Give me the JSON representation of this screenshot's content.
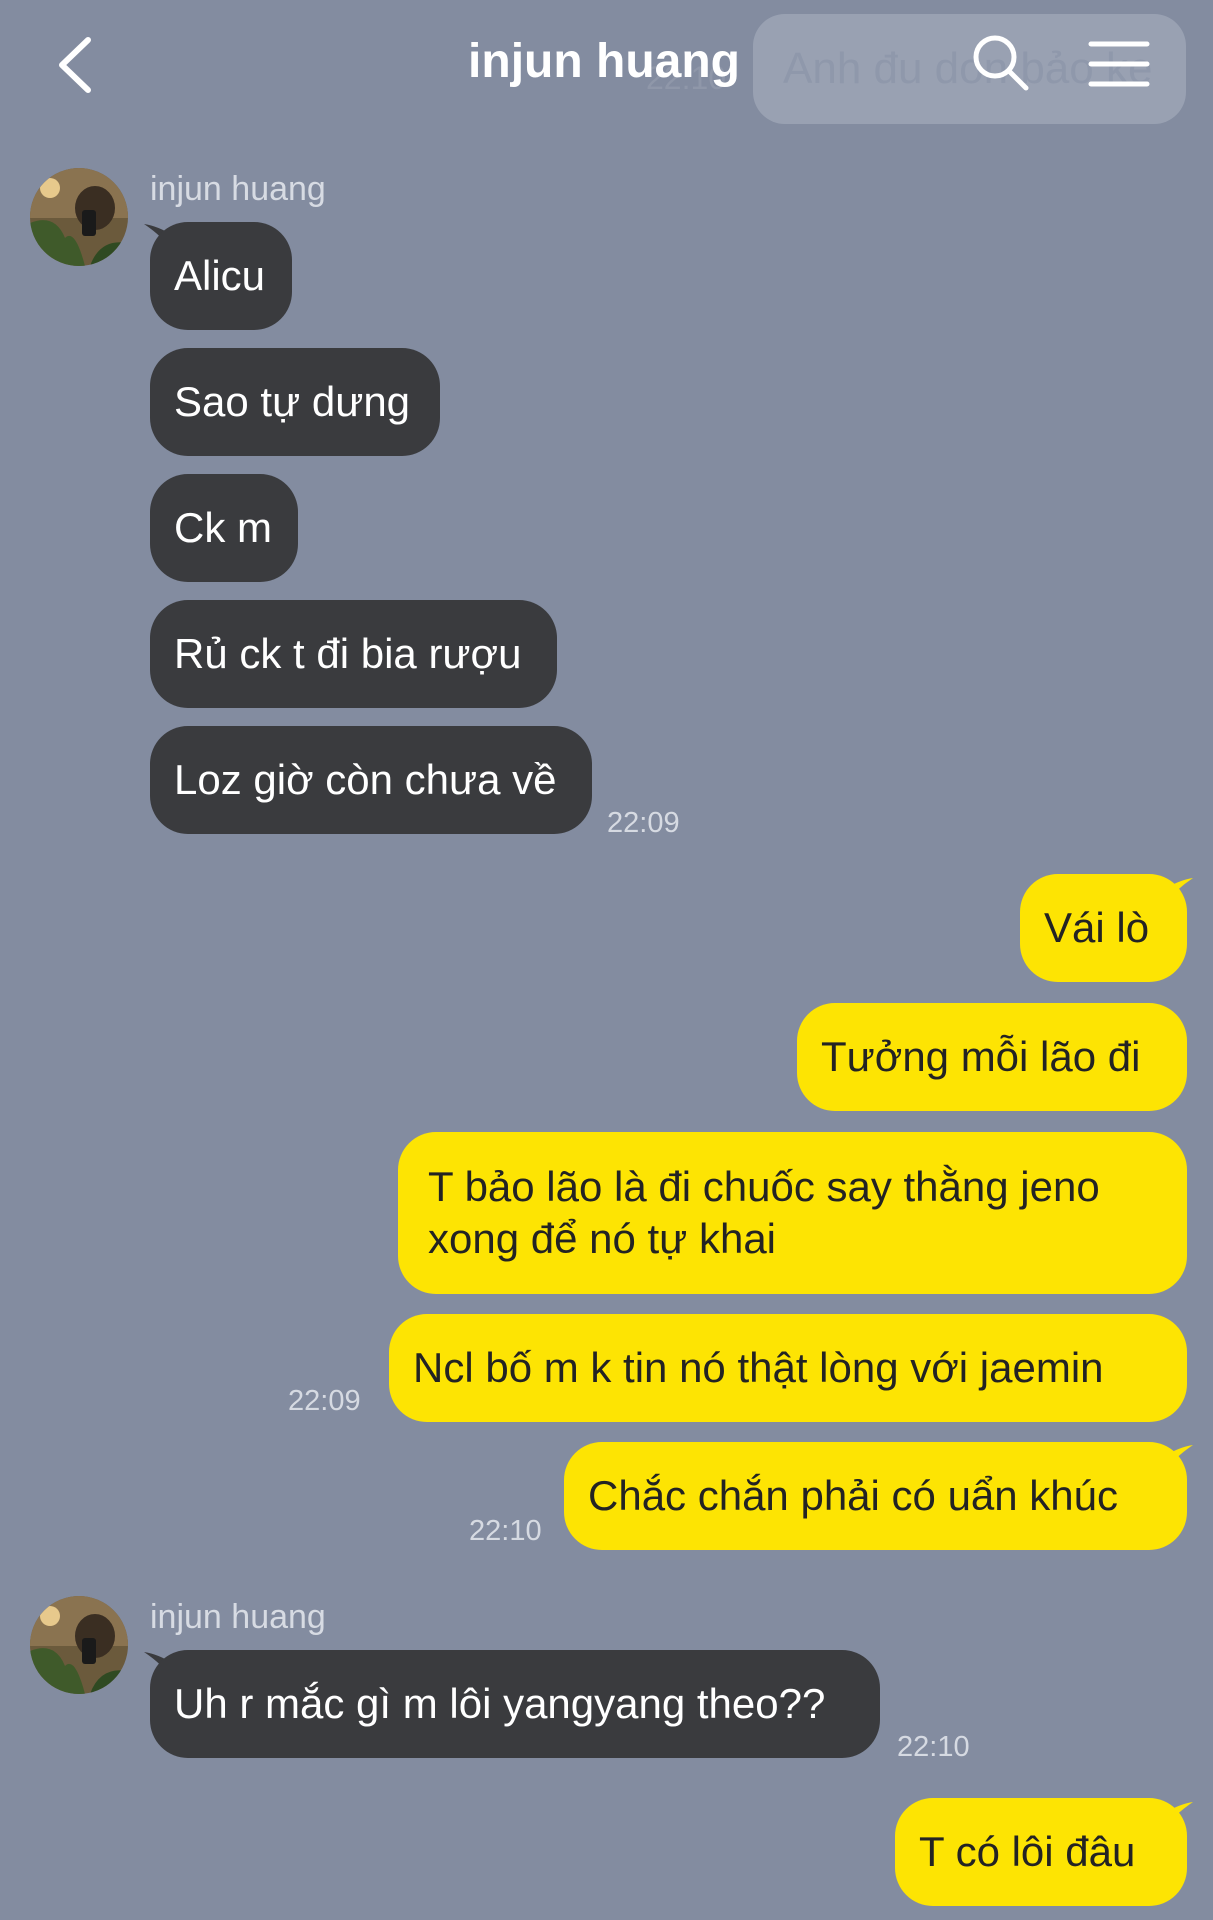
{
  "header": {
    "title": "injun huang",
    "search_pill_text": "Anh đu don bảo ke",
    "ghost_time": "22:10"
  },
  "colors": {
    "background": "#838ca0",
    "incoming_bubble": "#3a3b3e",
    "outgoing_bubble": "#fde403"
  },
  "groups": [
    {
      "sender": "injun huang",
      "messages": [
        "Alicu",
        "Sao tự dưng",
        "Ck m",
        "Rủ ck t đi bia rượu",
        "Loz giờ còn chưa về"
      ],
      "time": "22:09"
    },
    {
      "messages": [
        "Vái lò",
        "Tưởng mỗi lão đi",
        "T bảo lão là đi chuốc say thằng jeno xong để nó tự khai",
        "Ncl bố m k tin nó thật lòng với jaemin"
      ],
      "time": "22:09"
    },
    {
      "messages": [
        "Chắc chắn phải có uẩn khúc"
      ],
      "time": "22:10"
    },
    {
      "sender": "injun huang",
      "messages": [
        "Uh r mắc gì m lôi yangyang theo??"
      ],
      "time": "22:10"
    },
    {
      "messages": [
        "T có lôi đâu"
      ]
    }
  ]
}
